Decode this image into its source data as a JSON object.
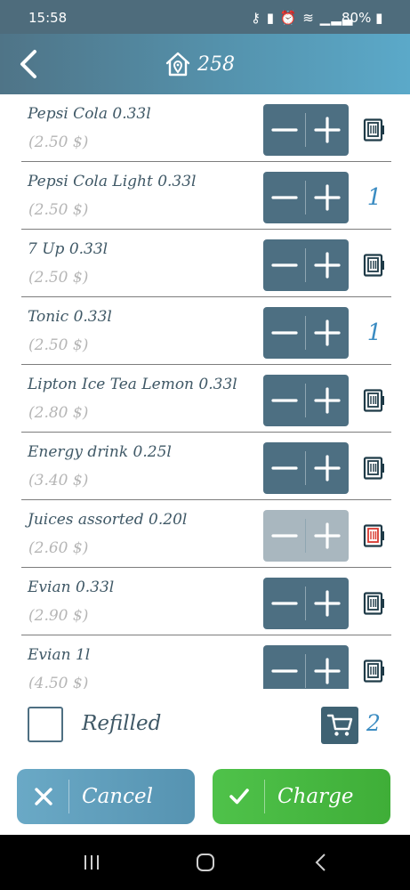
{
  "status_bar": {
    "time": "15:58",
    "icons": [
      "key-icon",
      "battery-saver-icon",
      "alarm-icon",
      "wifi-icon",
      "signal-icon"
    ],
    "battery": "80%"
  },
  "header": {
    "room_icon": "location-home-icon",
    "room_number": "258"
  },
  "products": [
    {
      "name": "Pepsi Cola 0.33l",
      "price": "(2.50 $)",
      "qty": "",
      "status_icon": "fridge-icon",
      "status_color": "#1e3a47",
      "disabled": false
    },
    {
      "name": "Pepsi Cola Light 0.33l",
      "price": "(2.50 $)",
      "qty": "1",
      "status_icon": "",
      "status_color": "",
      "disabled": false
    },
    {
      "name": "7 Up 0.33l",
      "price": "(2.50 $)",
      "qty": "",
      "status_icon": "fridge-icon",
      "status_color": "#1e3a47",
      "disabled": false
    },
    {
      "name": "Tonic 0.33l",
      "price": "(2.50 $)",
      "qty": "1",
      "status_icon": "",
      "status_color": "",
      "disabled": false
    },
    {
      "name": "Lipton Ice Tea Lemon 0.33l",
      "price": "(2.80 $)",
      "qty": "",
      "status_icon": "fridge-icon",
      "status_color": "#1e3a47",
      "disabled": false
    },
    {
      "name": "Energy drink 0.25l",
      "price": "(3.40 $)",
      "qty": "",
      "status_icon": "fridge-icon",
      "status_color": "#1e3a47",
      "disabled": false
    },
    {
      "name": "Juices assorted 0.20l",
      "price": "(2.60 $)",
      "qty": "",
      "status_icon": "fridge-icon",
      "status_color": "#d9382f",
      "disabled": true
    },
    {
      "name": "Evian 0.33l",
      "price": "(2.90 $)",
      "qty": "",
      "status_icon": "fridge-icon",
      "status_color": "#1e3a47",
      "disabled": false
    },
    {
      "name": "Evian 1l",
      "price": "(4.50 $)",
      "qty": "",
      "status_icon": "fridge-icon",
      "status_color": "#1e3a47",
      "disabled": false
    }
  ],
  "bottom": {
    "refilled_label": "Refilled",
    "refilled_checked": false,
    "cart_count": "2",
    "cancel_label": "Cancel",
    "charge_label": "Charge"
  },
  "colors": {
    "header_start": "#4f7487",
    "header_end": "#5ba9c9",
    "stepper": "#4d6f82",
    "accent_blue": "#3b8cc2",
    "cancel": "#5e9fbd",
    "charge": "#46b940"
  }
}
